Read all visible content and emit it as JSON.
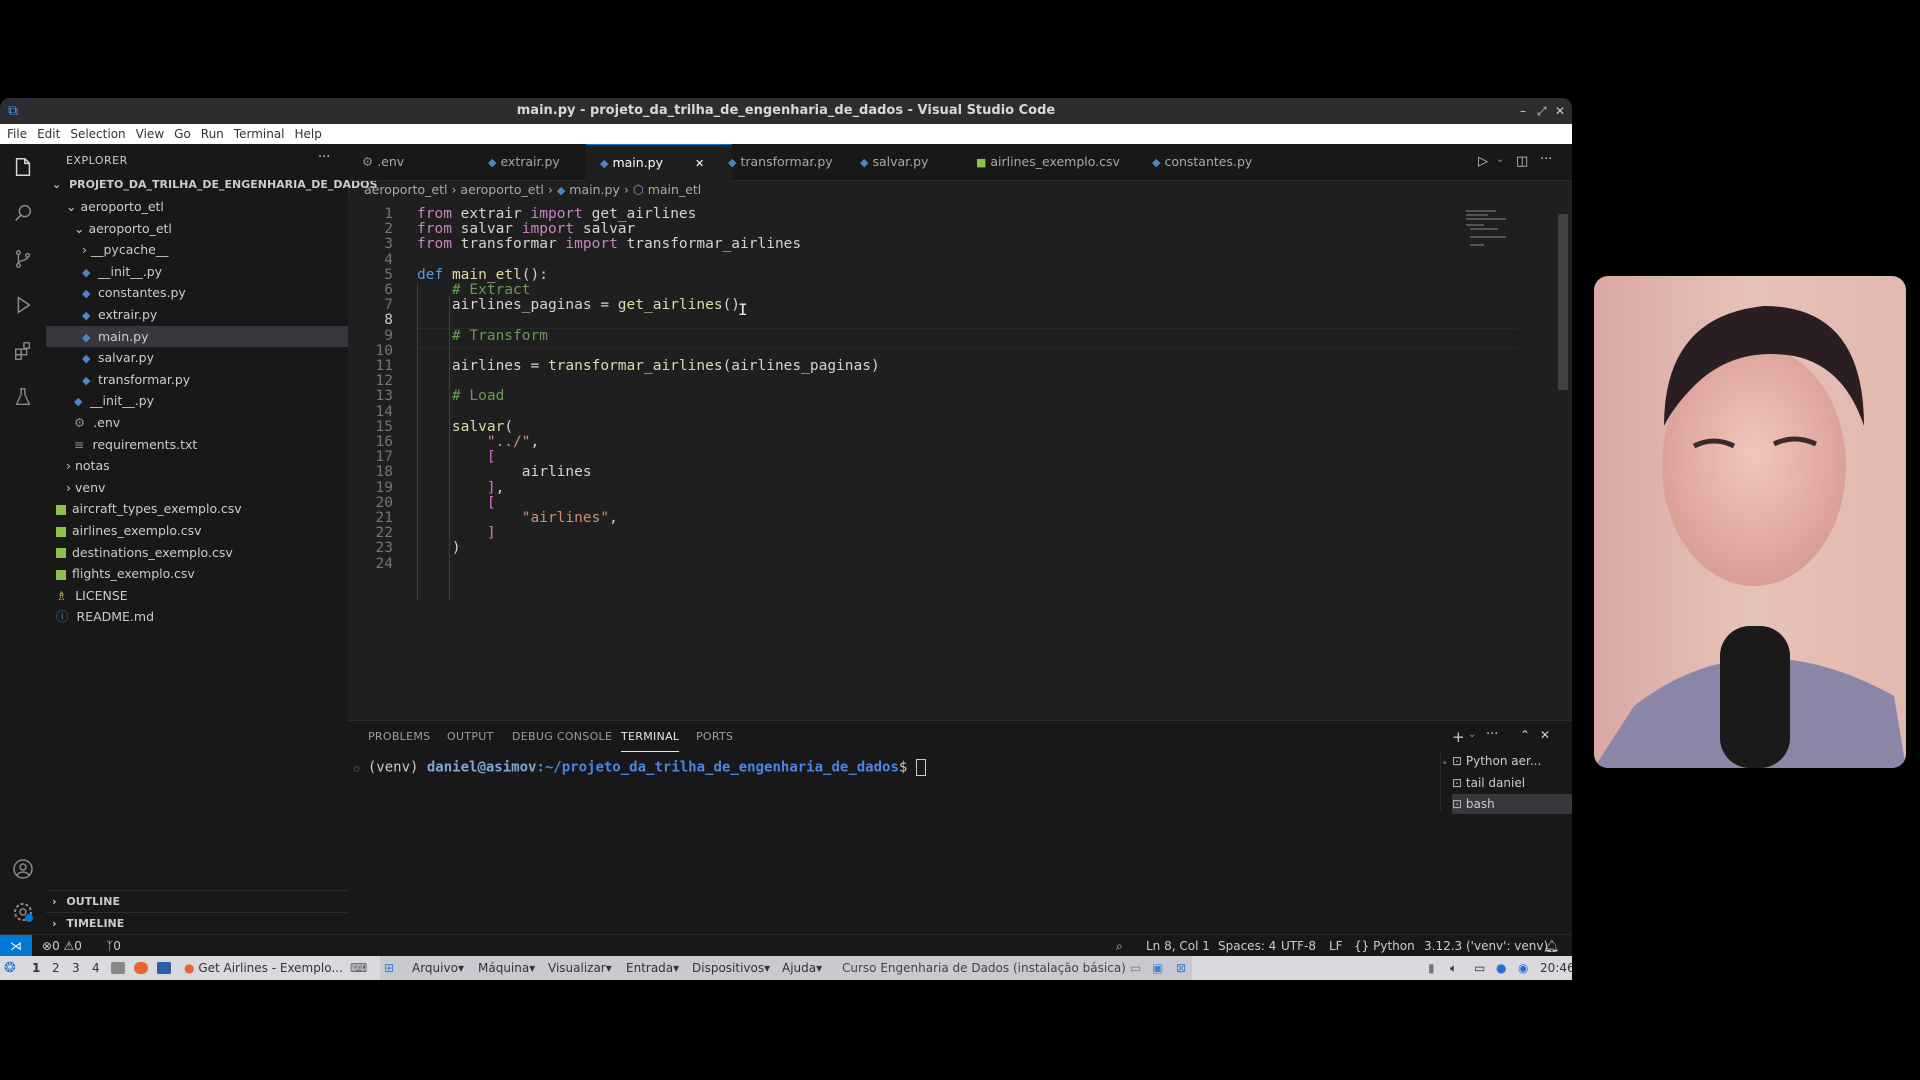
{
  "window": {
    "title": "main.py - projeto_da_trilha_de_engenharia_de_dados - Visual Studio Code",
    "minimize": "–",
    "maximize": "⤢",
    "close": "✕"
  },
  "menu": [
    "File",
    "Edit",
    "Selection",
    "View",
    "Go",
    "Run",
    "Terminal",
    "Help"
  ],
  "explorer": {
    "title": "EXPLORER",
    "more": "···",
    "root": "PROJETO_DA_TRILHA_DE_ENGENHARIA_DE_DADOS",
    "items": [
      {
        "label": "aeroporto_etl",
        "chev": "⌄",
        "icon": ""
      },
      {
        "label": "aeroporto_etl",
        "chev": "⌄",
        "icon": ""
      },
      {
        "label": "__pycache__",
        "chev": "›",
        "icon": ""
      },
      {
        "label": "__init__.py",
        "chev": "",
        "icon": "◆"
      },
      {
        "label": "constantes.py",
        "chev": "",
        "icon": "◆"
      },
      {
        "label": "extrair.py",
        "chev": "",
        "icon": "◆"
      },
      {
        "label": "main.py",
        "chev": "",
        "icon": "◆"
      },
      {
        "label": "salvar.py",
        "chev": "",
        "icon": "◆"
      },
      {
        "label": "transformar.py",
        "chev": "",
        "icon": "◆"
      },
      {
        "label": "__init__.py",
        "chev": "",
        "icon": "◆"
      },
      {
        "label": ".env",
        "chev": "",
        "icon": "⚙"
      },
      {
        "label": "requirements.txt",
        "chev": "",
        "icon": "≡"
      },
      {
        "label": "notas",
        "chev": "›",
        "icon": ""
      },
      {
        "label": "venv",
        "chev": "›",
        "icon": ""
      },
      {
        "label": "aircraft_types_exemplo.csv",
        "chev": "",
        "icon": "csv"
      },
      {
        "label": "airlines_exemplo.csv",
        "chev": "",
        "icon": "csv"
      },
      {
        "label": "destinations_exemplo.csv",
        "chev": "",
        "icon": "csv"
      },
      {
        "label": "flights_exemplo.csv",
        "chev": "",
        "icon": "csv"
      },
      {
        "label": "LICENSE",
        "chev": "",
        "icon": "♗"
      },
      {
        "label": "README.md",
        "chev": "",
        "icon": "ⓘ"
      }
    ],
    "outline": "OUTLINE",
    "timeline": "TIMELINE"
  },
  "tabs": [
    {
      "label": ".env",
      "icon": "⚙"
    },
    {
      "label": "extrair.py",
      "icon": "◆"
    },
    {
      "label": "main.py",
      "icon": "◆",
      "close": "✕"
    },
    {
      "label": "transformar.py",
      "icon": "◆"
    },
    {
      "label": "salvar.py",
      "icon": "◆"
    },
    {
      "label": "airlines_exemplo.csv",
      "icon": "■"
    },
    {
      "label": "constantes.py",
      "icon": "◆"
    }
  ],
  "breadcrumb": [
    "aeroporto_etl",
    "aeroporto_etl",
    "main.py",
    "main_etl"
  ],
  "code": {
    "line_numbers": [
      "1",
      "2",
      "3",
      "4",
      "5",
      "6",
      "7",
      "8",
      "9",
      "10",
      "11",
      "12",
      "13",
      "14",
      "15",
      "16",
      "17",
      "18",
      "19",
      "20",
      "21",
      "22",
      "23",
      "24"
    ],
    "lines": [
      "from extrair import get_airlines",
      "from salvar import salvar",
      "from transformar import transformar_airlines",
      "",
      "def main_etl():",
      "    # Extract",
      "    airlines_paginas = get_airlines()",
      "",
      "    # Transform",
      "",
      "    airlines = transformar_airlines(airlines_paginas)",
      "",
      "    # Load",
      "",
      "    salvar(",
      "        \"../\",",
      "        [",
      "            airlines",
      "        ],",
      "        [",
      "            \"airlines\",",
      "        ]",
      "    )",
      ""
    ]
  },
  "panel": {
    "tabs": [
      "PROBLEMS",
      "OUTPUT",
      "DEBUG CONSOLE",
      "TERMINAL",
      "PORTS"
    ],
    "terminal_line": {
      "venv": "(venv)",
      "userhost": "daniel@asimov",
      "path": ":~/projeto_da_trilha_de_engenharia_de_dados",
      "prompt": "$"
    },
    "terminals": [
      "Python aer...",
      "tail daniel",
      "bash"
    ]
  },
  "status": {
    "errors": "0",
    "warnings": "0",
    "ports": "0",
    "position": "Ln 8, Col 1",
    "spaces": "Spaces: 4",
    "encoding": "UTF-8",
    "eol": "LF",
    "language": "Python",
    "interpreter": "3.12.3 ('venv': venv)"
  },
  "taskbar": {
    "workspaces": [
      "1",
      "2",
      "3",
      "4"
    ],
    "browser_title": "Get Airlines - Exemplo...",
    "vm_menus": [
      "Arquivo",
      "Máquina",
      "Visualizar",
      "Entrada",
      "Dispositivos",
      "Ajuda"
    ],
    "vm_title": "Curso Engenharia de Dados (instalação básica)",
    "clock": "20:46"
  },
  "colors": {
    "accent": "#0078d4",
    "editor_bg": "#1f1f1f",
    "sidebar_bg": "#181818"
  }
}
